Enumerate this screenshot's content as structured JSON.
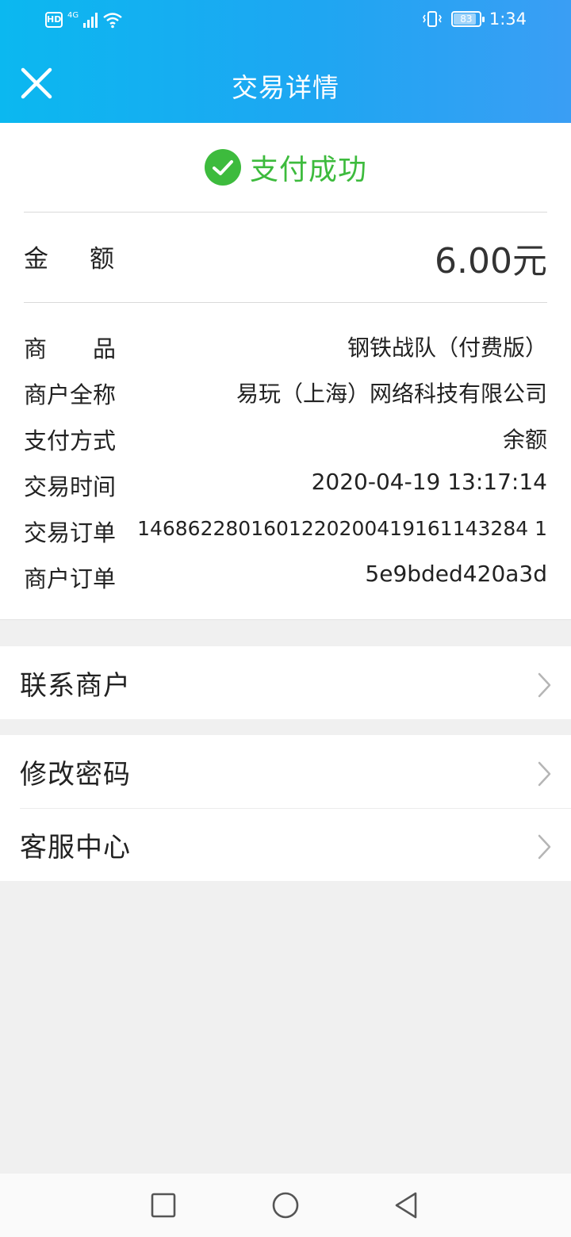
{
  "status_bar": {
    "hd": "HD",
    "network": "4G",
    "battery": "83",
    "time": "1:34"
  },
  "header": {
    "title": "交易详情",
    "close_icon": "close-icon"
  },
  "payment": {
    "status": "支付成功",
    "status_color": "#3dbb3d",
    "amount_label": "金额",
    "amount_value": "6.00元"
  },
  "details": [
    {
      "label": "商品",
      "value": "钢铁战队（付费版）"
    },
    {
      "label": "商户全称",
      "value": "易玩（上海）网络科技有限公司"
    },
    {
      "label": "支付方式",
      "value": "余额"
    },
    {
      "label": "交易时间",
      "value": "2020-04-19 13:17:14"
    },
    {
      "label": "交易订单",
      "value": "1468622801601220200419161143284 1"
    },
    {
      "label": "商户订单",
      "value": "5e9bded420a3d"
    }
  ],
  "menu_groups": [
    {
      "items": [
        {
          "label": "联系商户"
        }
      ]
    },
    {
      "items": [
        {
          "label": "修改密码"
        },
        {
          "label": "客服中心"
        }
      ]
    }
  ],
  "colors": {
    "header_start": "#0bb8f0",
    "header_end": "#3a9ef4",
    "success": "#3dbb3d"
  }
}
